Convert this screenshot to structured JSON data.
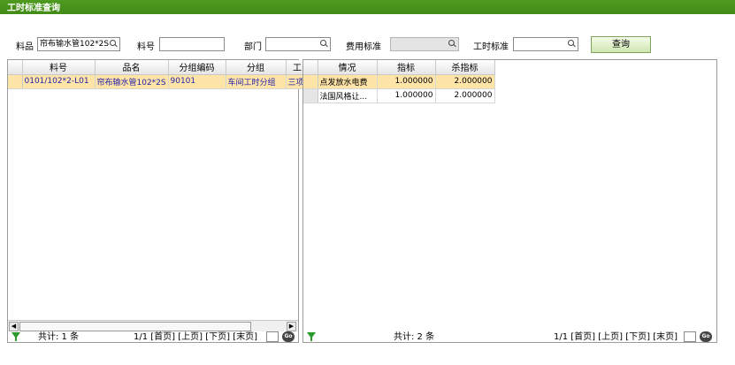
{
  "title": "工时标准查询",
  "search": {
    "material_label": "料品",
    "material_value": "帘布输水管102*2S",
    "item_no_label": "料号",
    "item_no_value": "",
    "dept_label": "部门",
    "dept_value": "",
    "cost_std_label": "费用标准",
    "cost_std_value": "",
    "labor_std_label": "工时标准",
    "labor_std_value": "",
    "query_label": "查询"
  },
  "left_table": {
    "columns": [
      "料号",
      "品名",
      "分组编码",
      "分组",
      "工"
    ],
    "rows": [
      [
        "0101/102*2-L01",
        "帘布输水管102*2S",
        "90101",
        "车间工时分组",
        "三项"
      ]
    ],
    "footer_total": "共计: 1 条",
    "footer_pager": "1/1 [首页] [上页] [下页] [末页]",
    "go_label": "Go"
  },
  "right_table": {
    "columns": [
      "情况",
      "指标",
      "杀指标"
    ],
    "rows": [
      [
        "点发放水电费",
        "1.000000",
        "2.000000"
      ],
      [
        "法国风格让...",
        "1.000000",
        "2.000000"
      ]
    ],
    "footer_total": "共计: 2 条",
    "footer_pager": "1/1 [首页] [上页] [下页] [末页]",
    "go_label": "Go"
  },
  "icons": {
    "search_icon": "magnifier",
    "filter_icon": "funnel",
    "go_icon": "go-circle"
  },
  "colors": {
    "titlebar": "#3d8614",
    "selected_row": "#ffe4a8",
    "link_text": "#2222aa",
    "filter_icon": "#2c9a2c"
  }
}
